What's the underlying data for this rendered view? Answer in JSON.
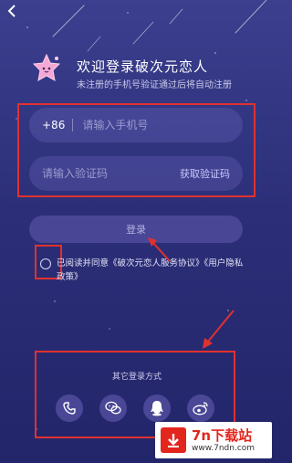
{
  "header": {
    "back_icon": "chevron-left-icon",
    "title": "欢迎登录破次元恋人",
    "subtitle": "未注册的手机号验证通过后将自动注册"
  },
  "form": {
    "country_code": "+86",
    "phone_placeholder": "请输入手机号",
    "code_placeholder": "请输入验证码",
    "get_code_label": "获取验证码"
  },
  "login_button_label": "登录",
  "agreement": {
    "text": "已阅读并同意《破次元恋人服务协议》《用户隐私政策》"
  },
  "other_login": {
    "label": "其它登录方式",
    "methods": [
      "phone-icon",
      "wechat-icon",
      "qq-icon",
      "weibo-icon"
    ]
  },
  "watermark": {
    "title": "7n下载站",
    "url": "www.7ndn.com"
  },
  "colors": {
    "background": "#2c2f78",
    "highlight_box": "#e0312f",
    "input_fill": "#5b55a8"
  }
}
